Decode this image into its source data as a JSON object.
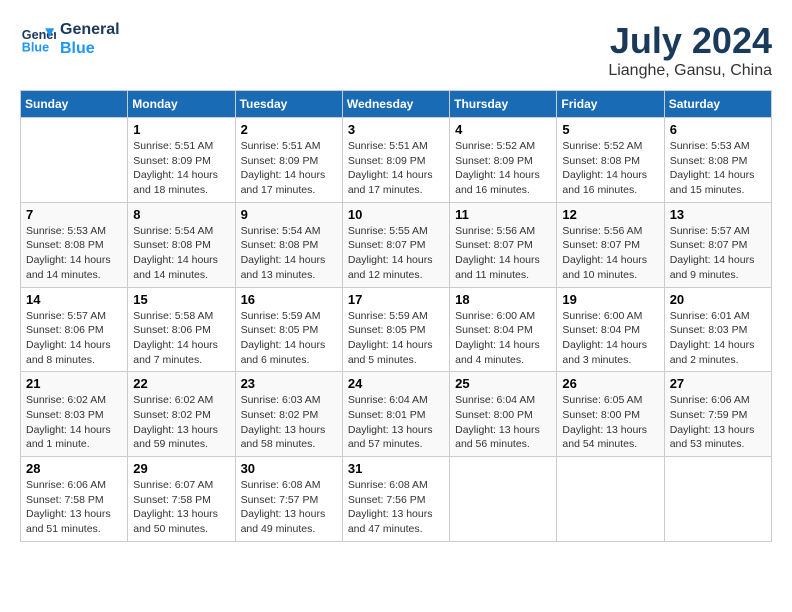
{
  "header": {
    "logo_line1": "General",
    "logo_line2": "Blue",
    "month": "July 2024",
    "location": "Lianghe, Gansu, China"
  },
  "weekdays": [
    "Sunday",
    "Monday",
    "Tuesday",
    "Wednesday",
    "Thursday",
    "Friday",
    "Saturday"
  ],
  "weeks": [
    [
      {
        "day": "",
        "sunrise": "",
        "sunset": "",
        "daylight": ""
      },
      {
        "day": "1",
        "sunrise": "Sunrise: 5:51 AM",
        "sunset": "Sunset: 8:09 PM",
        "daylight": "Daylight: 14 hours and 18 minutes."
      },
      {
        "day": "2",
        "sunrise": "Sunrise: 5:51 AM",
        "sunset": "Sunset: 8:09 PM",
        "daylight": "Daylight: 14 hours and 17 minutes."
      },
      {
        "day": "3",
        "sunrise": "Sunrise: 5:51 AM",
        "sunset": "Sunset: 8:09 PM",
        "daylight": "Daylight: 14 hours and 17 minutes."
      },
      {
        "day": "4",
        "sunrise": "Sunrise: 5:52 AM",
        "sunset": "Sunset: 8:09 PM",
        "daylight": "Daylight: 14 hours and 16 minutes."
      },
      {
        "day": "5",
        "sunrise": "Sunrise: 5:52 AM",
        "sunset": "Sunset: 8:08 PM",
        "daylight": "Daylight: 14 hours and 16 minutes."
      },
      {
        "day": "6",
        "sunrise": "Sunrise: 5:53 AM",
        "sunset": "Sunset: 8:08 PM",
        "daylight": "Daylight: 14 hours and 15 minutes."
      }
    ],
    [
      {
        "day": "7",
        "sunrise": "Sunrise: 5:53 AM",
        "sunset": "Sunset: 8:08 PM",
        "daylight": "Daylight: 14 hours and 14 minutes."
      },
      {
        "day": "8",
        "sunrise": "Sunrise: 5:54 AM",
        "sunset": "Sunset: 8:08 PM",
        "daylight": "Daylight: 14 hours and 14 minutes."
      },
      {
        "day": "9",
        "sunrise": "Sunrise: 5:54 AM",
        "sunset": "Sunset: 8:08 PM",
        "daylight": "Daylight: 14 hours and 13 minutes."
      },
      {
        "day": "10",
        "sunrise": "Sunrise: 5:55 AM",
        "sunset": "Sunset: 8:07 PM",
        "daylight": "Daylight: 14 hours and 12 minutes."
      },
      {
        "day": "11",
        "sunrise": "Sunrise: 5:56 AM",
        "sunset": "Sunset: 8:07 PM",
        "daylight": "Daylight: 14 hours and 11 minutes."
      },
      {
        "day": "12",
        "sunrise": "Sunrise: 5:56 AM",
        "sunset": "Sunset: 8:07 PM",
        "daylight": "Daylight: 14 hours and 10 minutes."
      },
      {
        "day": "13",
        "sunrise": "Sunrise: 5:57 AM",
        "sunset": "Sunset: 8:07 PM",
        "daylight": "Daylight: 14 hours and 9 minutes."
      }
    ],
    [
      {
        "day": "14",
        "sunrise": "Sunrise: 5:57 AM",
        "sunset": "Sunset: 8:06 PM",
        "daylight": "Daylight: 14 hours and 8 minutes."
      },
      {
        "day": "15",
        "sunrise": "Sunrise: 5:58 AM",
        "sunset": "Sunset: 8:06 PM",
        "daylight": "Daylight: 14 hours and 7 minutes."
      },
      {
        "day": "16",
        "sunrise": "Sunrise: 5:59 AM",
        "sunset": "Sunset: 8:05 PM",
        "daylight": "Daylight: 14 hours and 6 minutes."
      },
      {
        "day": "17",
        "sunrise": "Sunrise: 5:59 AM",
        "sunset": "Sunset: 8:05 PM",
        "daylight": "Daylight: 14 hours and 5 minutes."
      },
      {
        "day": "18",
        "sunrise": "Sunrise: 6:00 AM",
        "sunset": "Sunset: 8:04 PM",
        "daylight": "Daylight: 14 hours and 4 minutes."
      },
      {
        "day": "19",
        "sunrise": "Sunrise: 6:00 AM",
        "sunset": "Sunset: 8:04 PM",
        "daylight": "Daylight: 14 hours and 3 minutes."
      },
      {
        "day": "20",
        "sunrise": "Sunrise: 6:01 AM",
        "sunset": "Sunset: 8:03 PM",
        "daylight": "Daylight: 14 hours and 2 minutes."
      }
    ],
    [
      {
        "day": "21",
        "sunrise": "Sunrise: 6:02 AM",
        "sunset": "Sunset: 8:03 PM",
        "daylight": "Daylight: 14 hours and 1 minute."
      },
      {
        "day": "22",
        "sunrise": "Sunrise: 6:02 AM",
        "sunset": "Sunset: 8:02 PM",
        "daylight": "Daylight: 13 hours and 59 minutes."
      },
      {
        "day": "23",
        "sunrise": "Sunrise: 6:03 AM",
        "sunset": "Sunset: 8:02 PM",
        "daylight": "Daylight: 13 hours and 58 minutes."
      },
      {
        "day": "24",
        "sunrise": "Sunrise: 6:04 AM",
        "sunset": "Sunset: 8:01 PM",
        "daylight": "Daylight: 13 hours and 57 minutes."
      },
      {
        "day": "25",
        "sunrise": "Sunrise: 6:04 AM",
        "sunset": "Sunset: 8:00 PM",
        "daylight": "Daylight: 13 hours and 56 minutes."
      },
      {
        "day": "26",
        "sunrise": "Sunrise: 6:05 AM",
        "sunset": "Sunset: 8:00 PM",
        "daylight": "Daylight: 13 hours and 54 minutes."
      },
      {
        "day": "27",
        "sunrise": "Sunrise: 6:06 AM",
        "sunset": "Sunset: 7:59 PM",
        "daylight": "Daylight: 13 hours and 53 minutes."
      }
    ],
    [
      {
        "day": "28",
        "sunrise": "Sunrise: 6:06 AM",
        "sunset": "Sunset: 7:58 PM",
        "daylight": "Daylight: 13 hours and 51 minutes."
      },
      {
        "day": "29",
        "sunrise": "Sunrise: 6:07 AM",
        "sunset": "Sunset: 7:58 PM",
        "daylight": "Daylight: 13 hours and 50 minutes."
      },
      {
        "day": "30",
        "sunrise": "Sunrise: 6:08 AM",
        "sunset": "Sunset: 7:57 PM",
        "daylight": "Daylight: 13 hours and 49 minutes."
      },
      {
        "day": "31",
        "sunrise": "Sunrise: 6:08 AM",
        "sunset": "Sunset: 7:56 PM",
        "daylight": "Daylight: 13 hours and 47 minutes."
      },
      {
        "day": "",
        "sunrise": "",
        "sunset": "",
        "daylight": ""
      },
      {
        "day": "",
        "sunrise": "",
        "sunset": "",
        "daylight": ""
      },
      {
        "day": "",
        "sunrise": "",
        "sunset": "",
        "daylight": ""
      }
    ]
  ]
}
